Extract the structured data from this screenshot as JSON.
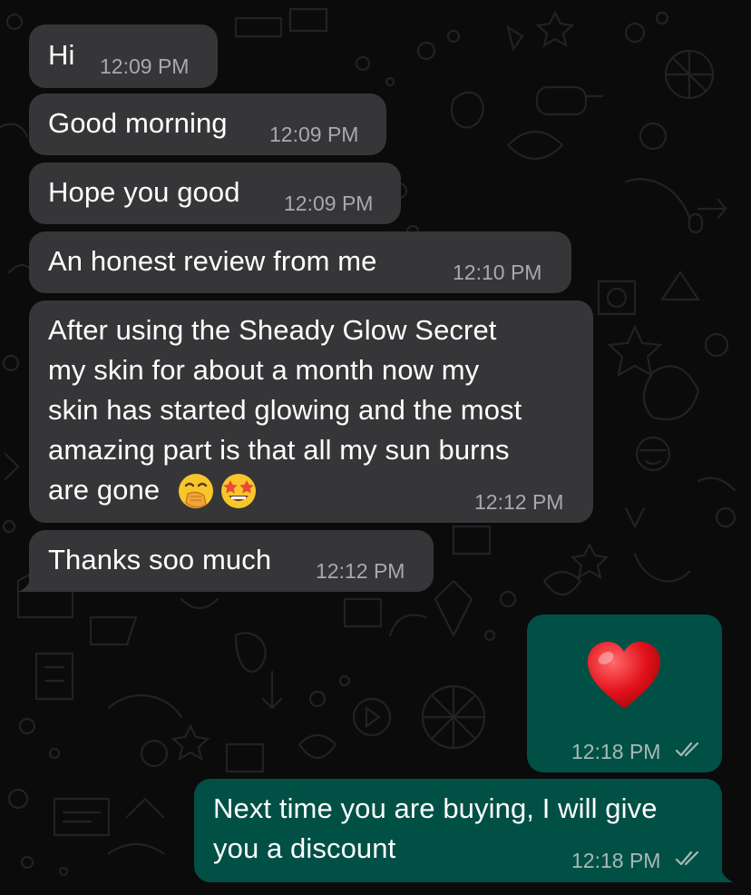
{
  "chat": {
    "colors": {
      "incoming_bubble": "#363638",
      "outgoing_bubble": "#005046",
      "background": "#0b0b0b",
      "timestamp_incoming": "#a9a9ad",
      "read_ticks": "#aab8b4"
    },
    "messages": [
      {
        "direction": "incoming",
        "text": "Hi",
        "time": "12:09 PM"
      },
      {
        "direction": "incoming",
        "text": "Good morning",
        "time": "12:09 PM"
      },
      {
        "direction": "incoming",
        "text": "Hope you good",
        "time": "12:09 PM"
      },
      {
        "direction": "incoming",
        "text": "An honest review from me",
        "time": "12:10 PM"
      },
      {
        "direction": "incoming",
        "lines": [
          "After using the Sheady Glow Secret",
          "my skin for about a month now my",
          "skin has started glowing and the most",
          "amazing part is that all my sun burns",
          "are gone"
        ],
        "emojis": [
          "hand-over-mouth-emoji",
          "star-struck-emoji"
        ],
        "time": "12:12 PM"
      },
      {
        "direction": "incoming",
        "text": "Thanks soo much",
        "time": "12:12 PM"
      },
      {
        "direction": "outgoing",
        "emoji": "red-heart-emoji",
        "time": "12:18 PM",
        "status": "read"
      },
      {
        "direction": "outgoing",
        "lines": [
          "Next time you are buying, I will give",
          "you a discount"
        ],
        "time": "12:18 PM",
        "status": "read"
      }
    ]
  }
}
